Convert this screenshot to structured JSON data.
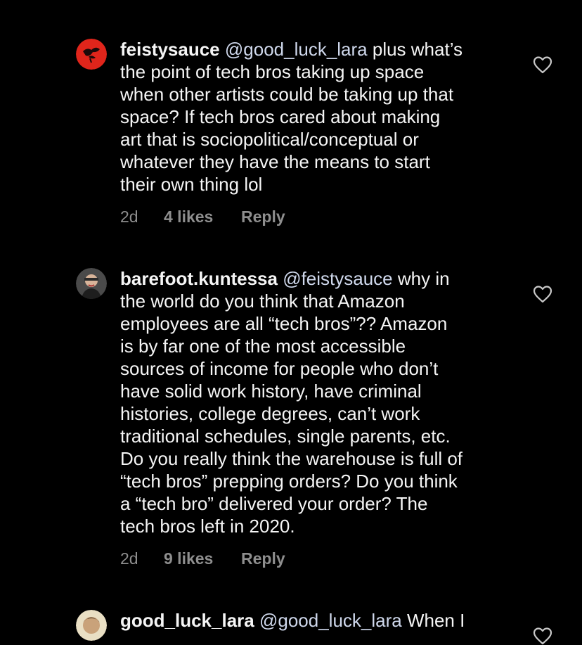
{
  "comments": [
    {
      "username": "feistysauce",
      "mention": "@good_luck_lara",
      "text_first": " plus what’s",
      "lines": [
        "the point of tech bros taking up space",
        "when other artists could be taking up that",
        "space? If tech bros cared about making",
        "art that is sociopolitical/conceptual or",
        "whatever they have the means to start",
        "their own thing lol"
      ],
      "age": "2d",
      "likes": "4 likes",
      "reply": "Reply",
      "avatar_color": "#e0251b"
    },
    {
      "username": "barefoot.kuntessa",
      "mention": "@feistysauce",
      "text_first": " why in",
      "lines": [
        "the world do you think that Amazon",
        "employees are all “tech bros”?? Amazon",
        "is by far one of the most accessible",
        "sources of income for people who don’t",
        "have solid work history, have criminal",
        "histories, college degrees, can’t work",
        "traditional schedules, single parents, etc.",
        "Do you really think the warehouse is full of",
        "“tech bros” prepping orders? Do you think",
        "a “tech bro” delivered your order? The",
        "tech bros left in 2020."
      ],
      "age": "2d",
      "likes": "9 likes",
      "reply": "Reply",
      "avatar_color": "#6b6b6b"
    },
    {
      "username": "good_luck_lara",
      "mention": "@good_luck_lara",
      "text_first": " When I",
      "lines": [],
      "avatar_color": "#d9c79a"
    }
  ]
}
